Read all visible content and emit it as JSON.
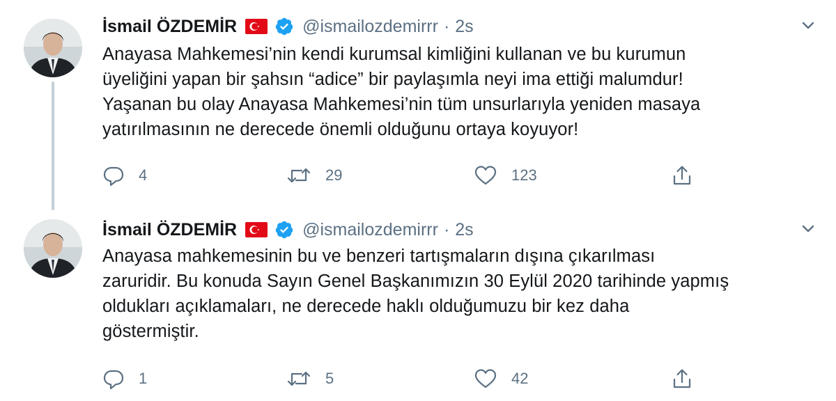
{
  "tweets": [
    {
      "author_name": "İsmail ÖZDEMİR",
      "handle": "@ismailozdemirrr",
      "separator": "·",
      "time": "2s",
      "text_lines": [
        "Anayasa Mahkemesi’nin kendi kurumsal kimliğini kullanan ve bu kurumun",
        "üyeliğini yapan bir şahsın “adice” bir paylaşımla neyi ima ettiği malumdur!",
        "Yaşanan bu olay Anayasa Mahkemesi’nin tüm unsurlarıyla yeniden masaya",
        "yatırılmasının ne derecede önemli olduğunu ortaya koyuyor!"
      ],
      "replies": "4",
      "retweets": "29",
      "likes": "123"
    },
    {
      "author_name": "İsmail ÖZDEMİR",
      "handle": "@ismailozdemirrr",
      "separator": "·",
      "time": "2s",
      "text_lines": [
        "Anayasa mahkemesinin bu ve benzeri tartışmaların dışına çıkarılması",
        "zaruridir. Bu konuda Sayın Genel Başkanımızın 30 Eylül 2020 tarihinde yapmış",
        "oldukları açıklamaları, ne derecede haklı olduğumuzu bir kez daha",
        "göstermiştir."
      ],
      "replies": "1",
      "retweets": "5",
      "likes": "42"
    }
  ],
  "icons": {
    "flag": "turkey-flag-icon",
    "verified": "verified-badge-icon",
    "caret": "chevron-down-icon",
    "reply": "reply-icon",
    "retweet": "retweet-icon",
    "like": "heart-icon",
    "share": "share-icon"
  },
  "colors": {
    "verified_blue": "#1da1f2",
    "flag_red": "#e30a17",
    "secondary_text": "#5b7083",
    "thread_line": "#c4cfd6"
  }
}
